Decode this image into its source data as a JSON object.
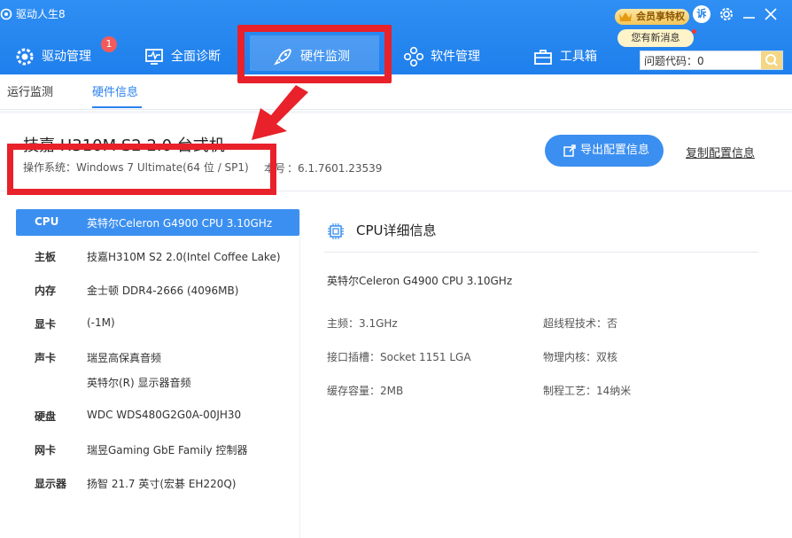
{
  "window": {
    "title": "驱动人生8",
    "vip_label": "会员享特权",
    "feedback_label": "诉",
    "message_bubble": "您有新消息"
  },
  "nav": {
    "tabs": [
      {
        "label": "驱动管理",
        "icon": "gear-icon",
        "badge": "1"
      },
      {
        "label": "全面诊断",
        "icon": "monitor-pulse-icon"
      },
      {
        "label": "硬件监测",
        "icon": "rocket-icon"
      },
      {
        "label": "软件管理",
        "icon": "apps-icon"
      },
      {
        "label": "工具箱",
        "icon": "toolbox-icon"
      }
    ],
    "active_tab": "硬件监测",
    "search_value": "问题代码：0"
  },
  "subtabs": [
    {
      "label": "运行监测"
    },
    {
      "label": "硬件信息"
    }
  ],
  "summary": {
    "machine": "技嘉 H310M S2 2.0 台式机",
    "os": "操作系统：Windows 7 Ultimate(64 位 / SP1)",
    "version_prefix": "本号",
    "version": "：6.1.7601.23539",
    "export_label": "导出配置信息",
    "copy_label": "复制配置信息"
  },
  "hardware": [
    {
      "key": "CPU",
      "value": "英特尔Celeron G4900 CPU 3.10GHz"
    },
    {
      "key": "主板",
      "value": "技嘉H310M S2 2.0(Intel Coffee Lake)"
    },
    {
      "key": "内存",
      "value": "金士顿 DDR4-2666 (4096MB)"
    },
    {
      "key": "显卡",
      "value": "(-1M)"
    },
    {
      "key": "声卡",
      "value": "瑞昱高保真音频"
    },
    {
      "key": "",
      "value": "英特尔(R) 显示器音频"
    },
    {
      "key": "硬盘",
      "value": "WDC WDS480G2G0A-00JH30"
    },
    {
      "key": "网卡",
      "value": "瑞昱Gaming GbE Family 控制器"
    },
    {
      "key": "显示器",
      "value": "扬智 21.7 英寸(宏碁 EH220Q)"
    }
  ],
  "detail": {
    "title": "CPU详细信息",
    "full_name": "英特尔Celeron G4900 CPU 3.10GHz",
    "specs": {
      "freq": "主频：3.1GHz",
      "hyperthread": "超线程技术：否",
      "socket": "接口插槽：Socket 1151 LGA",
      "cores": "物理内核：双核",
      "cache": "缓存容量：2MB",
      "process": "制程工艺：14纳米"
    }
  },
  "colors": {
    "header": "#2f8ff3",
    "accent": "#3b8ff0",
    "annotation": "#e8212a"
  }
}
